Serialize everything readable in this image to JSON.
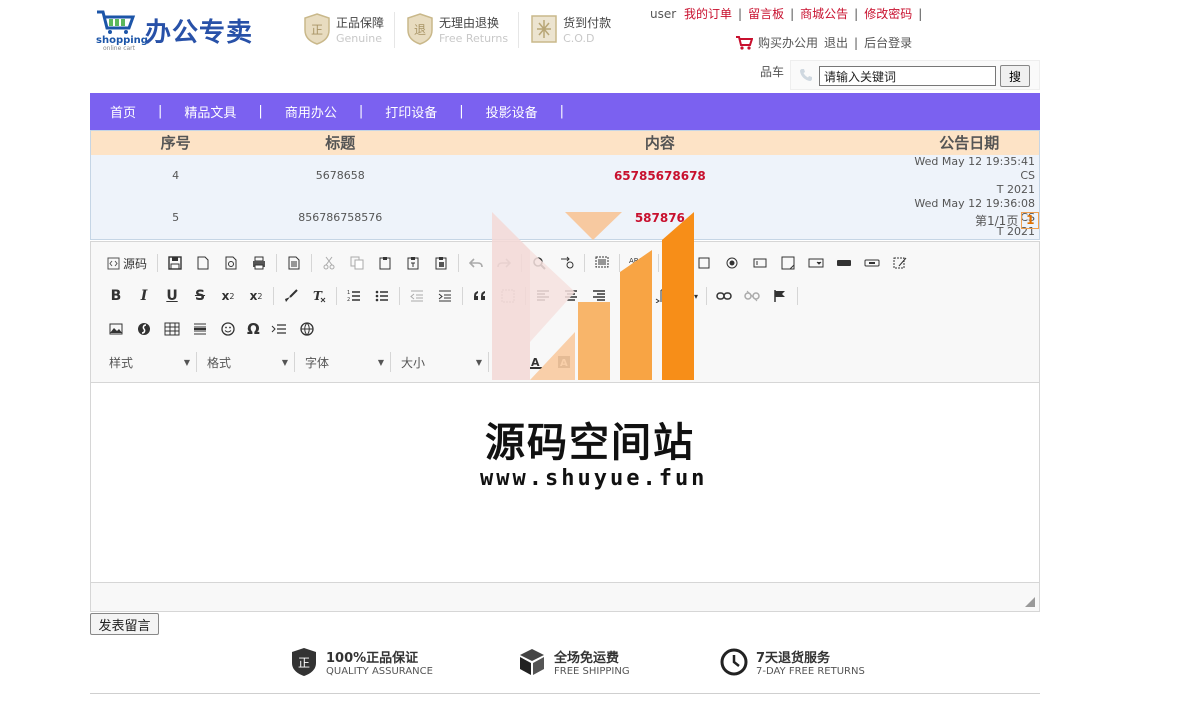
{
  "header": {
    "brand_word": "shopping",
    "brand_sub": "online cart",
    "brand_title": "办公专卖",
    "badges": [
      {
        "cn": "正品保障",
        "en": "Genuine",
        "icon": "genuine-shield-icon"
      },
      {
        "cn": "无理由退换",
        "en": "Free Returns",
        "icon": "return-shield-icon"
      },
      {
        "cn": "货到付款",
        "en": "C.O.D",
        "icon": "cod-icon"
      }
    ]
  },
  "topnav": {
    "user": "user",
    "links": [
      "我的订单",
      "留言板",
      "商城公告",
      "修改密码"
    ],
    "sep": "|"
  },
  "subnav": {
    "cart": "购买办公用",
    "logout": "退出",
    "admin": "后台登录",
    "sep": "|"
  },
  "search": {
    "cart_label": "品车",
    "value": "请输入关键词",
    "button": "搜"
  },
  "menu": {
    "items": [
      "首页",
      "精品文具",
      "商用办公",
      "打印设备",
      "投影设备"
    ],
    "sep": "|"
  },
  "table": {
    "headers": [
      "序号",
      "标题",
      "内容",
      "公告日期"
    ],
    "rows": [
      {
        "id": "4",
        "title": "5678658",
        "content": "65785678678",
        "date1": "Wed May 12 19:35:41 CS",
        "date2": "T 2021"
      },
      {
        "id": "5",
        "title": "856786758576",
        "content": "587876",
        "date1": "Wed May 12 19:36:08 CS",
        "date2": "T 2021"
      }
    ]
  },
  "pager": {
    "label": "第1/1页",
    "current": "1"
  },
  "editor": {
    "source_label": "源码",
    "style_combo": "样式",
    "format_combo": "格式",
    "font_combo": "字体",
    "size_combo": "大小"
  },
  "watermark": {
    "title": "源码空间站",
    "url": "www.shuyue.fun"
  },
  "submit": "发表留言",
  "footer": [
    {
      "cn": "100%正品保证",
      "en": "QUALITY ASSURANCE",
      "icon": "quality-shield-icon"
    },
    {
      "cn": "全场免运费",
      "en": "FREE SHIPPING",
      "icon": "package-icon"
    },
    {
      "cn": "7天退货服务",
      "en": "7-DAY FREE RETURNS",
      "icon": "clock-icon"
    }
  ],
  "colors": {
    "menu_bg": "#7b61f0",
    "table_header": "#fde3c6",
    "row_bg": "#eef3fa",
    "accent_red": "#c8102e",
    "brand_blue": "#2851a8"
  }
}
